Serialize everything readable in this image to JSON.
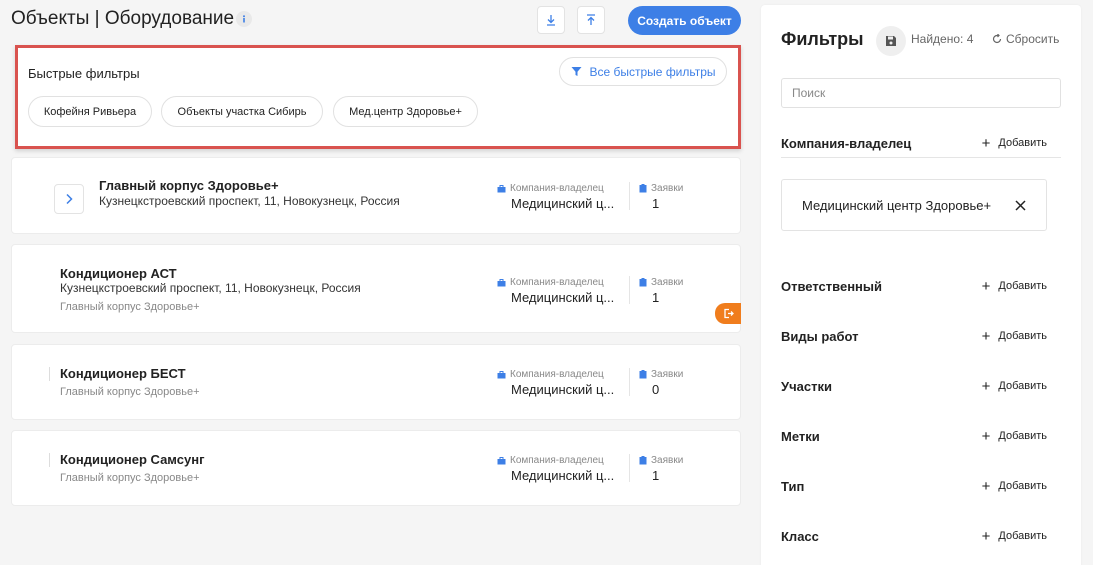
{
  "header": {
    "title": "Объекты | Оборудование",
    "create_label": "Создать объект"
  },
  "quick_filters": {
    "title": "Быстрые фильтры",
    "all_label": "Все быстрые фильтры",
    "chips": [
      "Кофейня Ривьера",
      "Объекты участка Сибирь",
      "Мед.центр Здоровье+"
    ]
  },
  "columns": {
    "company_label": "Компания-владелец",
    "requests_label": "Заявки"
  },
  "objects": [
    {
      "title": "Главный корпус Здоровье+",
      "address": "Кузнецкстроевский проспект, 11, Новокузнецк, Россия",
      "parent": "",
      "company": "Медицинский ц...",
      "requests": "1"
    },
    {
      "title": "Кондиционер АСТ",
      "address": "Кузнецкстроевский проспект, 11, Новокузнецк, Россия",
      "parent": "Главный корпус Здоровье+",
      "company": "Медицинский ц...",
      "requests": "1"
    },
    {
      "title": "Кондиционер БЕСТ",
      "address": "",
      "parent": "Главный корпус Здоровье+",
      "company": "Медицинский ц...",
      "requests": "0"
    },
    {
      "title": "Кондиционер Самсунг",
      "address": "",
      "parent": "Главный корпус Здоровье+",
      "company": "Медицинский ц...",
      "requests": "1"
    }
  ],
  "filters_panel": {
    "title": "Фильтры",
    "found": "Найдено: 4",
    "reset_label": "Сбросить",
    "search_placeholder": "Поиск",
    "add_label": "Добавить",
    "selected_company": "Медицинский центр Здоровье+",
    "groups": [
      "Компания-владелец",
      "Ответственный",
      "Виды работ",
      "Участки",
      "Метки",
      "Тип",
      "Класс"
    ]
  },
  "colors": {
    "accent": "#3d7fe6",
    "highlight_border": "#d9534f",
    "orange": "#f07d1d"
  }
}
